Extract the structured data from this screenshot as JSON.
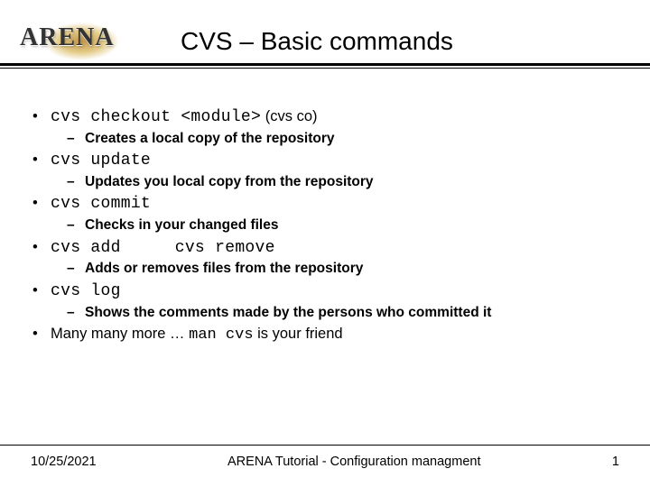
{
  "logo": "ARENA",
  "title": "CVS – Basic commands",
  "items": [
    {
      "cmd": "cvs checkout <module>",
      "suffix": "(cvs co)",
      "desc": "Creates a local copy of the repository"
    },
    {
      "cmd": "cvs update",
      "desc": "Updates you local copy from the repository"
    },
    {
      "cmd": "cvs commit",
      "desc": "Checks in your changed files"
    },
    {
      "cmd": "cvs add",
      "cmd2": "cvs remove",
      "desc": "Adds or removes  files from the repository"
    },
    {
      "cmd": "cvs log",
      "desc": "Shows the comments made by the persons who committed it"
    }
  ],
  "last_line_pre": "Many many more … ",
  "last_line_cmd": "man cvs",
  "last_line_post": " is your friend",
  "footer": {
    "date": "10/25/2021",
    "center": "ARENA Tutorial - Configuration managment",
    "page": "1"
  }
}
